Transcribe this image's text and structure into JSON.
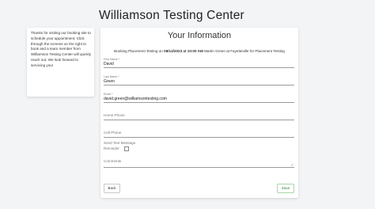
{
  "header": {
    "title": "Williamson Testing Center"
  },
  "sidebar": {
    "message": "Thanks for visiting our booking site to schedule your appointment. Click through the screens on the right to book and a team member from Williamson Testing Center will quickly reach out. We look forward to servicing you!"
  },
  "form": {
    "title": "Your Information",
    "booking": {
      "prefix": "Booking Placement Testing on",
      "datetime": "08/14/2023 at 10:00 AM",
      "suffix": "Martin Green at Fayetteville for Placement Testing"
    },
    "fields": {
      "first_name": {
        "label": "First Name *",
        "value": "David"
      },
      "last_name": {
        "label": "Last Name *",
        "value": "Green"
      },
      "email": {
        "label": "Email *",
        "value": "david.green@williamsontesting.com"
      },
      "home_phone": {
        "placeholder": "Home Phone"
      },
      "cell_phone": {
        "placeholder": "Cell Phone"
      },
      "sms_reminder": {
        "label_line1": "Send Text Message",
        "label_line2": "Reminder",
        "checked": false
      },
      "comments": {
        "placeholder": "Comments"
      }
    },
    "buttons": {
      "back": "Back",
      "save": "Save"
    }
  }
}
